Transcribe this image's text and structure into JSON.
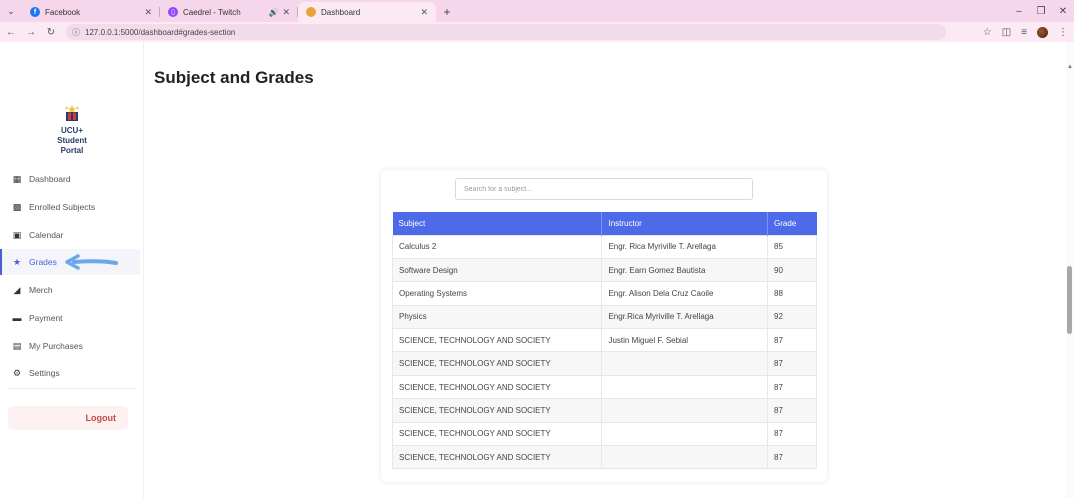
{
  "browser": {
    "tabs": [
      {
        "title": "Facebook",
        "favicon_color": "#1877f2"
      },
      {
        "title": "Caedrel - Twitch",
        "favicon_color": "#9146ff"
      },
      {
        "title": "Dashboard",
        "favicon_color": "#e8a33b"
      }
    ],
    "url": "127.0.0.1:5000/dashboard#grades-section"
  },
  "sidebar": {
    "brand": [
      "UCU+",
      "Student",
      "Portal"
    ],
    "items": [
      {
        "label": "Dashboard",
        "icon": "grid-icon"
      },
      {
        "label": "Enrolled Subjects",
        "icon": "book-icon"
      },
      {
        "label": "Calendar",
        "icon": "calendar-icon"
      },
      {
        "label": "Grades",
        "icon": "star-icon"
      },
      {
        "label": "Merch",
        "icon": "cart-icon"
      },
      {
        "label": "Payment",
        "icon": "credit-card-icon"
      },
      {
        "label": "My Purchases",
        "icon": "receipt-icon"
      },
      {
        "label": "Settings",
        "icon": "gear-icon"
      }
    ],
    "logout": "Logout",
    "accent": "#4a5fd6"
  },
  "main": {
    "title": "Subject and Grades",
    "search_placeholder": "Search for a subject...",
    "table": {
      "headers": [
        "Subject",
        "Instructor",
        "Grade"
      ],
      "rows": [
        [
          "Calculus 2",
          "Engr. Rica Myriville T. Arellaga",
          "85"
        ],
        [
          "Software Design",
          "Engr. Earn Gomez Bautista",
          "90"
        ],
        [
          "Operating Systems",
          "Engr. Alison Dela Cruz Caoile",
          "88"
        ],
        [
          "Physics",
          "Engr.Rica Myriville T. Arellaga",
          "92"
        ],
        [
          "SCIENCE, TECHNOLOGY AND SOCIETY",
          "Justin Miguel F. Sebial",
          "87"
        ],
        [
          "SCIENCE, TECHNOLOGY AND SOCIETY",
          "",
          "87"
        ],
        [
          "SCIENCE, TECHNOLOGY AND SOCIETY",
          "",
          "87"
        ],
        [
          "SCIENCE, TECHNOLOGY AND SOCIETY",
          "",
          "87"
        ],
        [
          "SCIENCE, TECHNOLOGY AND SOCIETY",
          "",
          "87"
        ],
        [
          "SCIENCE, TECHNOLOGY AND SOCIETY",
          "",
          "87"
        ]
      ],
      "header_color": "#4d6ae8"
    }
  }
}
